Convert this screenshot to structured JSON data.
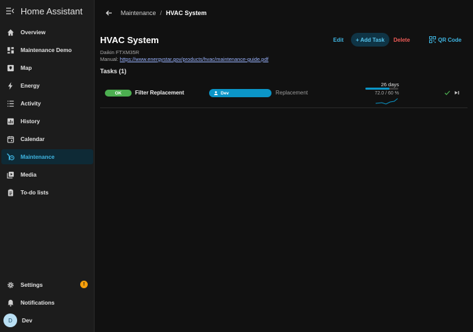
{
  "app": {
    "title": "Home Assistant"
  },
  "sidebar": {
    "items": [
      {
        "label": "Overview",
        "icon": "home-icon"
      },
      {
        "label": "Maintenance Demo",
        "icon": "dashboard-icon"
      },
      {
        "label": "Map",
        "icon": "map-icon"
      },
      {
        "label": "Energy",
        "icon": "lightning-icon"
      },
      {
        "label": "Activity",
        "icon": "list-icon"
      },
      {
        "label": "History",
        "icon": "chart-icon"
      },
      {
        "label": "Calendar",
        "icon": "calendar-icon"
      },
      {
        "label": "Maintenance",
        "icon": "wrench-clock-icon",
        "active": true
      },
      {
        "label": "Media",
        "icon": "media-icon"
      },
      {
        "label": "To-do lists",
        "icon": "clipboard-icon"
      }
    ],
    "settings_label": "Settings",
    "settings_badge": "!",
    "notifications_label": "Notifications",
    "user_name": "Dev",
    "user_initial": "D"
  },
  "breadcrumb": {
    "parent": "Maintenance",
    "separator": "/",
    "current": "HVAC System"
  },
  "device": {
    "title": "HVAC System",
    "model": "Daikin FTXM35R",
    "manual_label": "Manual:",
    "manual_url": "https://www.energystar.gov/products/hvac/maintenance-guide.pdf"
  },
  "actions": {
    "edit": "Edit",
    "add_task": "+ Add Task",
    "delete": "Delete",
    "qr_code": "QR Code"
  },
  "tasks": {
    "heading": "Tasks (1)",
    "rows": [
      {
        "status": "OK",
        "name": "Filter Replacement",
        "assignee": "Dev",
        "type": "Replacement",
        "days": "26 days",
        "progress": 0.72,
        "reading": "72.0 / 60 %"
      }
    ]
  },
  "colors": {
    "accent": "#3fb6e3",
    "ok": "#4caf50",
    "danger": "#ef5b57",
    "badge": "#f59e0b",
    "pill": "#0b95c7"
  }
}
